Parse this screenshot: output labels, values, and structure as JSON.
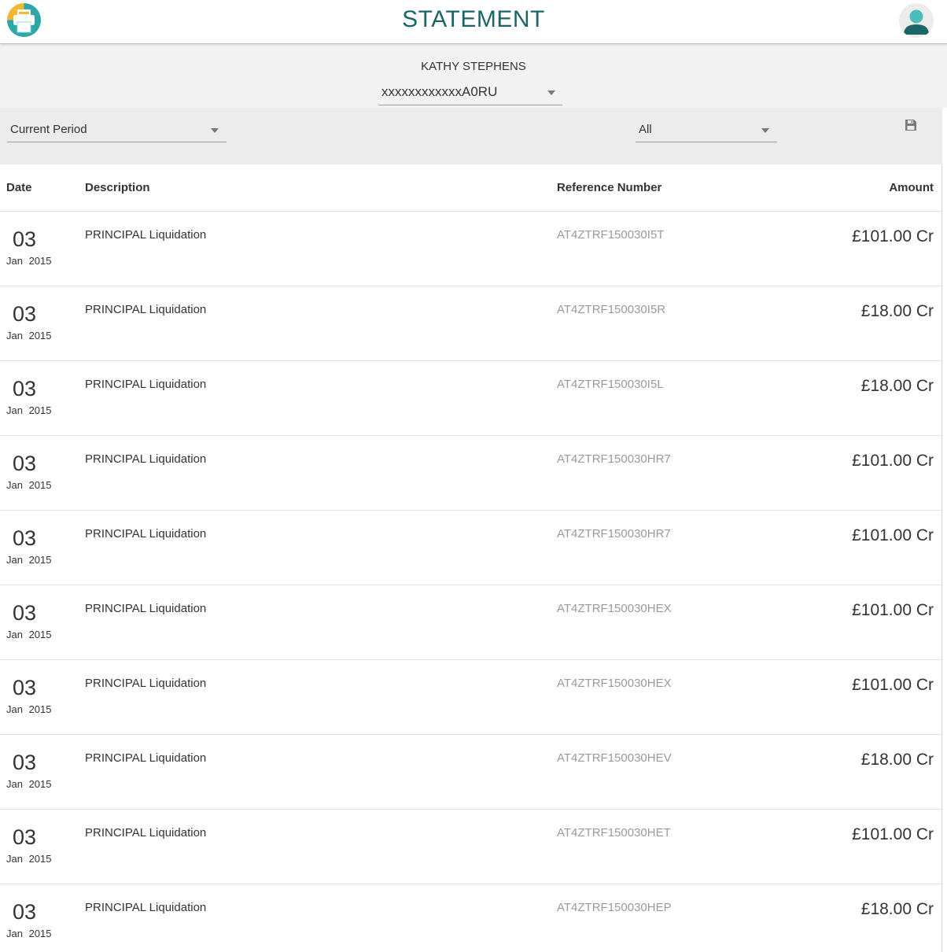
{
  "header": {
    "title": "STATEMENT",
    "logo_icon": "printer-logo-icon",
    "avatar_icon": "user-avatar-icon",
    "colors": {
      "title": "#1c6566",
      "logo_yellow": "#f5b731",
      "logo_teal": "#2ea7a8",
      "avatar_teal": "#4bbdbd",
      "avatar_dark": "#1c6566"
    }
  },
  "account": {
    "customer_name": "KATHY STEPHENS",
    "selected_account": "xxxxxxxxxxxxA0RU"
  },
  "filters": {
    "period": "Current Period",
    "type": "All",
    "save_icon": "save-icon"
  },
  "table": {
    "columns": [
      "Date",
      "Description",
      "Reference Number",
      "Amount"
    ],
    "rows": [
      {
        "day": "03",
        "month_year": "Jan 2015",
        "description": "PRINCIPAL Liquidation",
        "reference": "AT4ZTRF150030I5T",
        "amount": "£101.00 Cr"
      },
      {
        "day": "03",
        "month_year": "Jan 2015",
        "description": "PRINCIPAL Liquidation",
        "reference": "AT4ZTRF150030I5R",
        "amount": "£18.00 Cr"
      },
      {
        "day": "03",
        "month_year": "Jan 2015",
        "description": "PRINCIPAL Liquidation",
        "reference": "AT4ZTRF150030I5L",
        "amount": "£18.00 Cr"
      },
      {
        "day": "03",
        "month_year": "Jan 2015",
        "description": "PRINCIPAL Liquidation",
        "reference": "AT4ZTRF150030HR7",
        "amount": "£101.00 Cr"
      },
      {
        "day": "03",
        "month_year": "Jan 2015",
        "description": "PRINCIPAL Liquidation",
        "reference": "AT4ZTRF150030HR7",
        "amount": "£101.00 Cr"
      },
      {
        "day": "03",
        "month_year": "Jan 2015",
        "description": "PRINCIPAL Liquidation",
        "reference": "AT4ZTRF150030HEX",
        "amount": "£101.00 Cr"
      },
      {
        "day": "03",
        "month_year": "Jan 2015",
        "description": "PRINCIPAL Liquidation",
        "reference": "AT4ZTRF150030HEX",
        "amount": "£101.00 Cr"
      },
      {
        "day": "03",
        "month_year": "Jan 2015",
        "description": "PRINCIPAL Liquidation",
        "reference": "AT4ZTRF150030HEV",
        "amount": "£18.00 Cr"
      },
      {
        "day": "03",
        "month_year": "Jan 2015",
        "description": "PRINCIPAL Liquidation",
        "reference": "AT4ZTRF150030HET",
        "amount": "£101.00 Cr"
      },
      {
        "day": "03",
        "month_year": "Jan 2015",
        "description": "PRINCIPAL Liquidation",
        "reference": "AT4ZTRF150030HEP",
        "amount": "£18.00 Cr"
      }
    ]
  }
}
